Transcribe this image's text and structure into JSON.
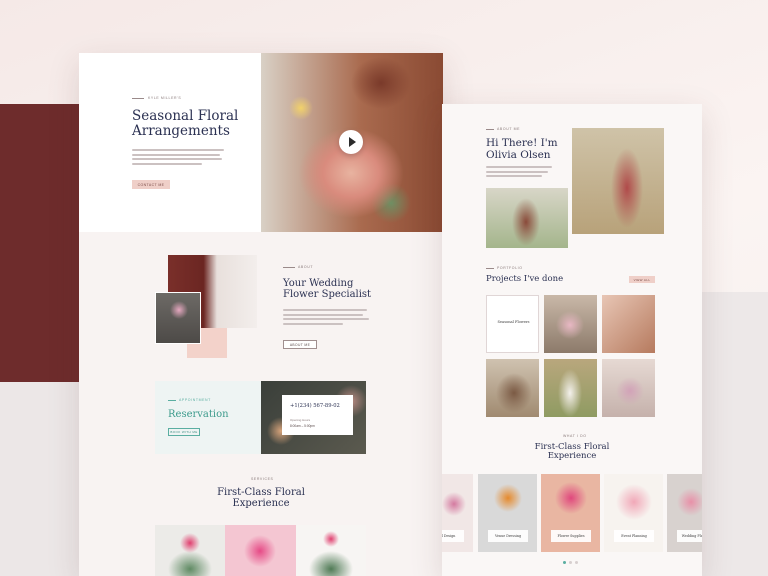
{
  "left": {
    "hero": {
      "eyebrow": "KYLE MILLER'S",
      "title_line1": "Seasonal Floral",
      "title_line2": "Arrangements",
      "cta": "CONTACT ME"
    },
    "about": {
      "eyebrow": "ABOUT",
      "title_line1": "Your Wedding",
      "title_line2": "Flower Specialist",
      "button": "ABOUT ME"
    },
    "reservation": {
      "eyebrow": "APPOINTMENT",
      "title": "Reservation",
      "button": "BOOK WITH ME",
      "phone": "+1(234) 567-89-02",
      "hours_label": "Opening Hours",
      "hours": "8:00am – 5:00pm"
    },
    "services": {
      "eyebrow": "SERVICES",
      "title_line1": "First-Class Floral",
      "title_line2": "Experience"
    }
  },
  "right": {
    "intro": {
      "eyebrow": "ABOUT ME",
      "title_line1": "Hi There! I'm",
      "title_line2": "Olivia Olsen"
    },
    "projects": {
      "eyebrow": "PORTFOLIO",
      "title": "Projects I've done",
      "button": "VIEW ALL",
      "tiles": [
        "Seasonal Flowers",
        "",
        "",
        "",
        "",
        ""
      ]
    },
    "experience": {
      "eyebrow": "WHAT I DO",
      "title_line1": "First-Class Floral",
      "title_line2": "Experience",
      "tiles": [
        "Bridal Design",
        "Venue Dressing",
        "Flower Supplies",
        "Event Planning",
        "Wedding Planning"
      ]
    }
  },
  "colors": {
    "maroon": "#6e2c2c",
    "navy": "#2b3152",
    "teal": "#3d9b8c",
    "blush": "#efcfc8"
  }
}
